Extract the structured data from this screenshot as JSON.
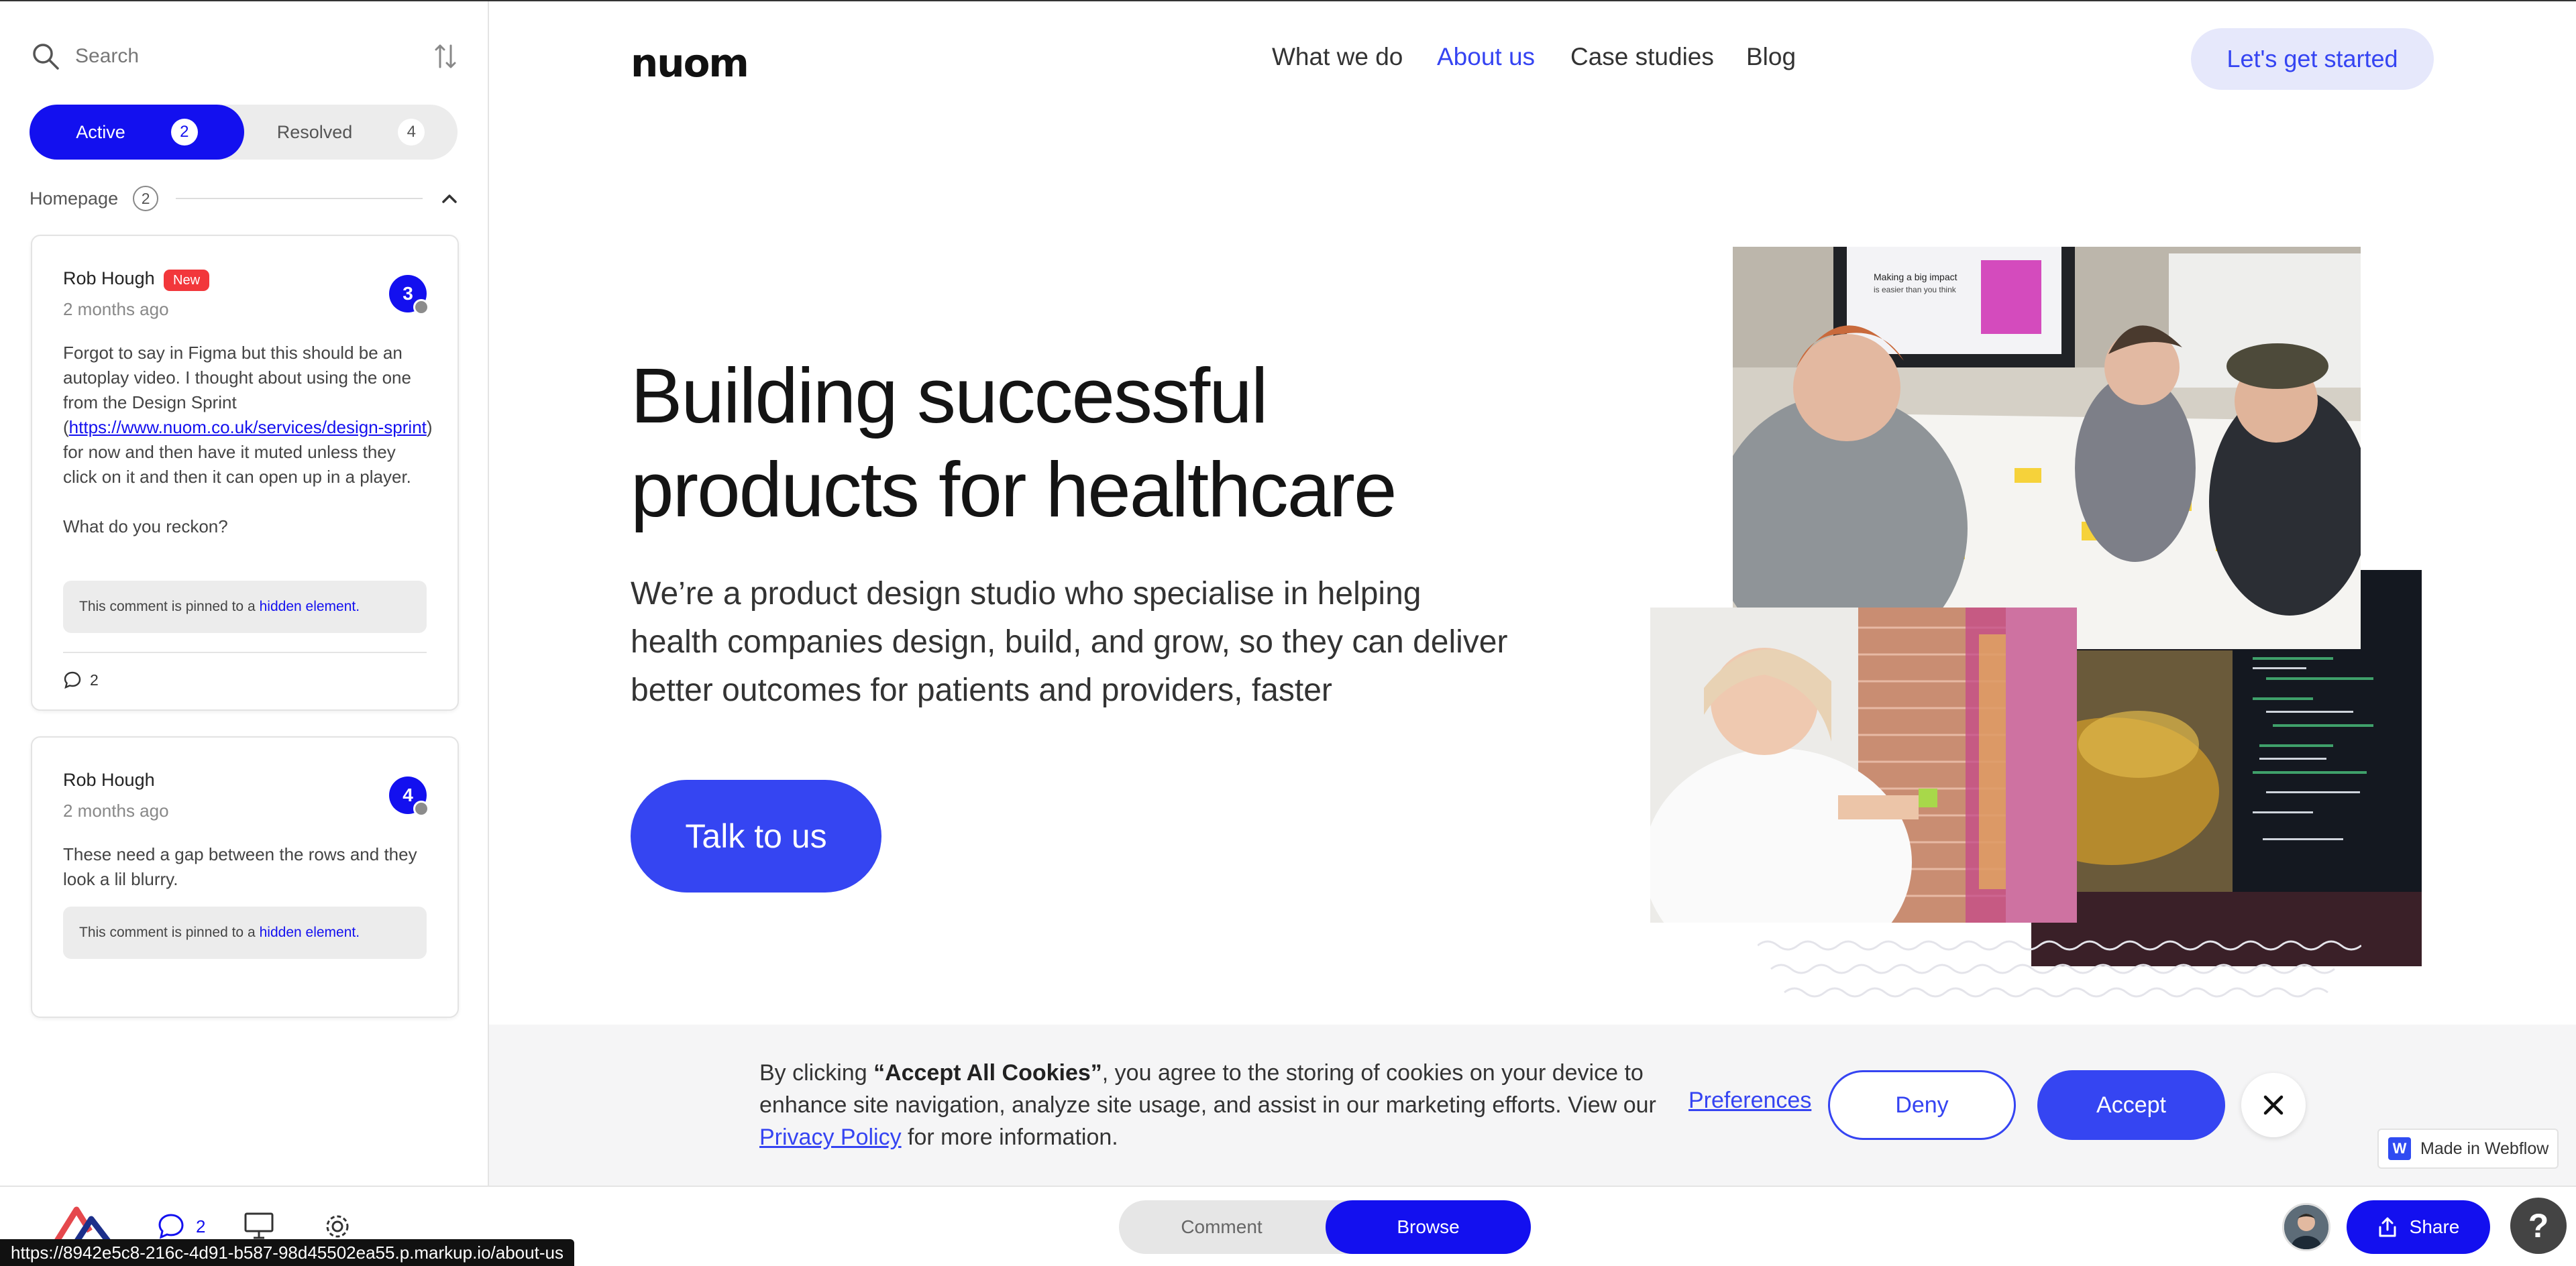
{
  "sidebar": {
    "search_placeholder": "Search",
    "tabs": {
      "active_label": "Active",
      "active_count": "2",
      "resolved_label": "Resolved",
      "resolved_count": "4"
    },
    "group": {
      "label": "Homepage",
      "count": "2"
    },
    "comments": [
      {
        "author": "Rob Hough",
        "badge": "New",
        "time": "2 months ago",
        "number": "3",
        "text_before": "Forgot to say in Figma but this should be an autoplay video. I thought about using the one from the Design Sprint (",
        "link": "https://www.nuom.co.uk/services/design-sprint",
        "text_after": ") for now  and then have it muted unless they click on it and then it can open up in a player.",
        "text_2": "What do you reckon?",
        "pin_prefix": "This comment is pinned to a",
        "pin_link": "hidden element.",
        "replies": "2"
      },
      {
        "author": "Rob Hough",
        "time": "2 months ago",
        "number": "4",
        "text": "These need a gap between the rows and they look a lil blurry.",
        "pin_prefix": "This comment is pinned to a",
        "pin_link": "hidden element."
      }
    ]
  },
  "site": {
    "logo": "nuom",
    "nav": [
      "What we do",
      "About us",
      "Case studies",
      "Blog"
    ],
    "nav_active": "About us",
    "cta_top": "Let's get started",
    "headline_1": "Building successful",
    "headline_2": "products for healthcare",
    "sub": "We’re a product design studio who specialise in helping health companies design, build, and grow, so they can deliver better outcomes for patients and providers, faster",
    "talk": "Talk to us",
    "photo_slide_title_1": "Making a big impact",
    "photo_slide_title_2": "is easier than you think",
    "accent": "#3544f2"
  },
  "cookie": {
    "text_pre": "By clicking ",
    "text_bold": "“Accept All Cookies”",
    "text_mid": ", you agree to the storing of cookies on your device to enhance site navigation, analyze site usage, and assist in our marketing efforts. View our ",
    "privacy": "Privacy Policy",
    "text_end": " for more information.",
    "preferences": "Preferences",
    "deny": "Deny",
    "accept": "Accept"
  },
  "webflow_badge": "Made in Webflow",
  "bottombar": {
    "comment_count": "2",
    "mode_comment": "Comment",
    "mode_browse": "Browse",
    "share": "Share",
    "help": "?"
  },
  "status_url": "https://8942e5c8-216c-4d91-b587-98d45502ea55.p.markup.io/about-us",
  "colors": {
    "primary": "#1310ef",
    "site_accent": "#3544f2",
    "badge_new": "#f2373b"
  }
}
